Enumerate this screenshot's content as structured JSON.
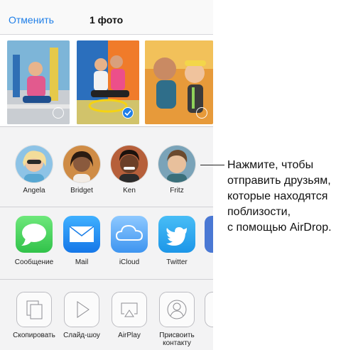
{
  "header": {
    "cancel_label": "Отменить",
    "title": "1 фото"
  },
  "photos": [
    {
      "kind": "video",
      "selected": false
    },
    {
      "kind": "photo",
      "selected": true
    },
    {
      "kind": "video",
      "selected": false
    }
  ],
  "airdrop": {
    "people": [
      {
        "name": "Angela"
      },
      {
        "name": "Bridget"
      },
      {
        "name": "Ken"
      },
      {
        "name": "Fritz"
      }
    ]
  },
  "apps": [
    {
      "label": "Сообщение",
      "icon": "messages-icon",
      "color": "#45d15a"
    },
    {
      "label": "Mail",
      "icon": "mail-icon",
      "color": "#1b8af3"
    },
    {
      "label": "iCloud",
      "icon": "icloud-icon",
      "color": "#4aa6ff"
    },
    {
      "label": "Twitter",
      "icon": "twitter-icon",
      "color": "#1fa3f2"
    }
  ],
  "actions": [
    {
      "label": "Скопировать",
      "icon": "copy-icon"
    },
    {
      "label": "Слайд-шоу",
      "icon": "slideshow-icon"
    },
    {
      "label": "AirPlay",
      "icon": "airplay-icon"
    },
    {
      "label": "Присвоить контакту",
      "icon": "assign-contact-icon"
    }
  ],
  "callout": {
    "lines": [
      "Нажмите, чтобы",
      "отправить друзьям,",
      "которые находятся",
      "поблизости,",
      "с помощью AirDrop."
    ]
  }
}
